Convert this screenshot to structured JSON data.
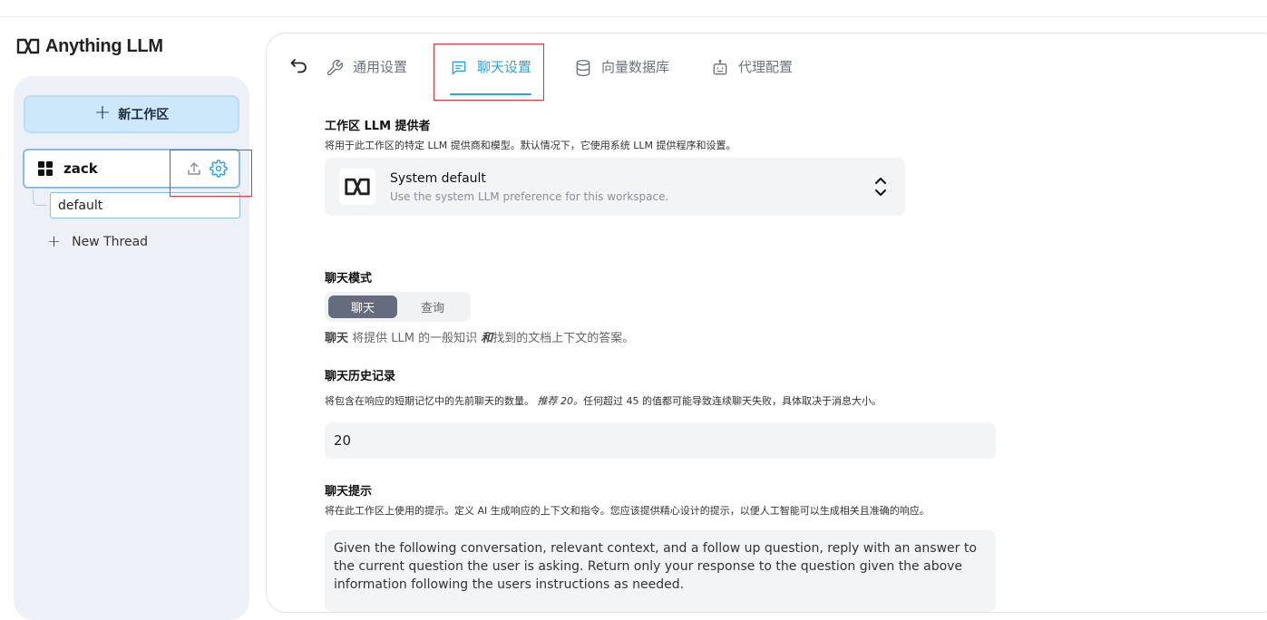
{
  "app": {
    "logo_text": "Anything LLM"
  },
  "sidebar": {
    "new_workspace_label": "新工作区",
    "workspace": {
      "name": "zack"
    },
    "threads": [
      {
        "label": "default"
      }
    ],
    "new_thread_label": "New Thread"
  },
  "tabs": [
    {
      "label": "通用设置",
      "icon": "wrench-icon",
      "active": false
    },
    {
      "label": "聊天设置",
      "icon": "chat-icon",
      "active": true
    },
    {
      "label": "向量数据库",
      "icon": "database-icon",
      "active": false
    },
    {
      "label": "代理配置",
      "icon": "robot-icon",
      "active": false
    }
  ],
  "llm_provider": {
    "title": "工作区 LLM 提供者",
    "description": "将用于此工作区的特定 LLM 提供商和模型。默认情况下，它使用系统 LLM 提供程序和设置。",
    "selected_name": "System default",
    "selected_sub": "Use the system LLM preference for this workspace."
  },
  "chat_mode": {
    "title": "聊天模式",
    "options": [
      "聊天",
      "查询"
    ],
    "selected": "聊天",
    "desc_strong": "聊天",
    "desc_mid": " 将提供 LLM 的一般知识 ",
    "desc_and": "和",
    "desc_end": "找到的文档上下文的答案。"
  },
  "chat_history": {
    "title": "聊天历史记录",
    "desc_start": "将包含在响应的短期记忆中的先前聊天的数量。",
    "desc_recommend": "推荐 20。",
    "desc_end": "任何超过 45 的值都可能导致连续聊天失败，具体取决于消息大小。",
    "value": "20"
  },
  "chat_prompt": {
    "title": "聊天提示",
    "description": "将在此工作区上使用的提示。定义 AI 生成响应的上下文和指令。您应该提供精心设计的提示，以便人工智能可以生成相关且准确的响应。",
    "value": "Given the following conversation, relevant context, and a follow up question, reply with an answer to the current question the user is asking. Return only your response to the question given the above information following the users instructions as needed."
  },
  "colors": {
    "accent": "#2aa4e5",
    "highlight_box": "#e0333b",
    "toggle_active": "#646c7d"
  }
}
